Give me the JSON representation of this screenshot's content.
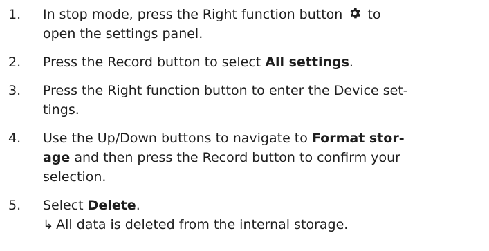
{
  "steps": [
    {
      "number": "1.",
      "line1_before_icon": "In stop mode, press the Right function button",
      "icon": "gear-icon",
      "line1_after_icon": "to",
      "line2": "open the settings panel."
    },
    {
      "number": "2.",
      "text_before": "Press the Record button to select ",
      "bold": "All settings",
      "text_after": "."
    },
    {
      "number": "3.",
      "line1": "Press the Right function button to enter the Device set-",
      "line2": "tings."
    },
    {
      "number": "4.",
      "line1_before": "Use the Up/Down buttons to navigate to ",
      "bold1": "Format stor-",
      "bold2": "age",
      "line2_after": " and then press the Record button to confirm your",
      "line3": "selection."
    },
    {
      "number": "5.",
      "text_before": "Select ",
      "bold": "Delete",
      "text_after": ".",
      "result_arrow": "↳",
      "result": "All data is deleted from the internal storage."
    }
  ]
}
